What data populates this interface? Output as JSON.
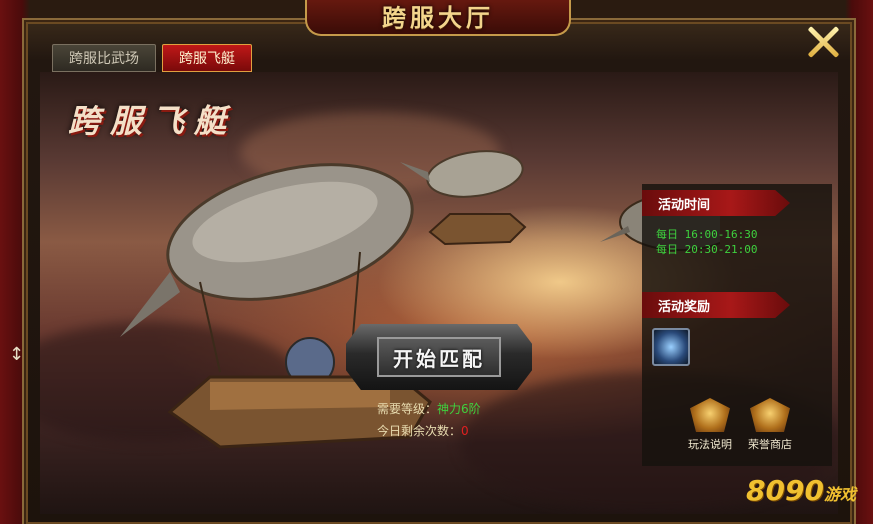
{
  "window": {
    "title": "跨服大厅"
  },
  "tabs": [
    {
      "label": "跨服比武场",
      "active": false
    },
    {
      "label": "跨服飞艇",
      "active": true
    }
  ],
  "heading": "跨服飞艇",
  "start_button": {
    "label": "开始匹配"
  },
  "requirement": {
    "label": "需要等级：",
    "value": "神力6阶"
  },
  "remaining": {
    "label": "今日剩余次数：",
    "value": "0"
  },
  "activity_time": {
    "title": "活动时间",
    "slots": [
      "每日 16:00-16:30",
      "每日 20:30-21:00"
    ]
  },
  "activity_reward": {
    "title": "活动奖励"
  },
  "buttons": {
    "rules": "玩法说明",
    "shop": "荣誉商店"
  },
  "watermark": {
    "number": "8090",
    "suffix": "游戏"
  },
  "colors": {
    "accent_red": "#a81818",
    "gold": "#f3d58c",
    "green_text": "#3ed13e",
    "red_text": "#e02020"
  },
  "icons": [
    "close-icon",
    "reward-item-icon",
    "rules-emblem-icon",
    "shop-emblem-icon",
    "resize-arrow-icon"
  ]
}
